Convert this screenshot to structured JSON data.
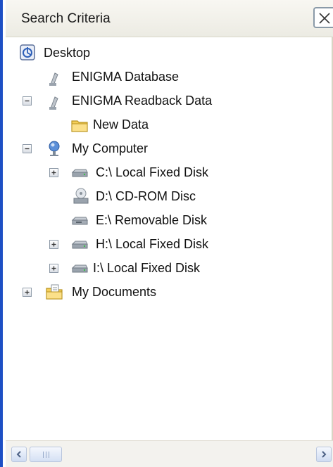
{
  "panel": {
    "title": "Search Criteria",
    "close_glyph": "X"
  },
  "tree": [
    {
      "label": "Desktop",
      "icon": "desktop-icon",
      "expander": "none",
      "depth": 0
    },
    {
      "label": "ENIGMA Database",
      "icon": "database-icon",
      "expander": "none",
      "depth": 1
    },
    {
      "label": "ENIGMA Readback Data",
      "icon": "database-icon",
      "expander": "minus",
      "depth": 1
    },
    {
      "label": "New Data",
      "icon": "folder-icon",
      "expander": "none",
      "depth": 2
    },
    {
      "label": "My Computer",
      "icon": "my-computer-icon",
      "expander": "minus",
      "depth": 1
    },
    {
      "label": "C:\\  Local Fixed Disk",
      "icon": "hard-drive-icon",
      "expander": "plus",
      "depth": 2
    },
    {
      "label": "D:\\  CD-ROM Disc",
      "icon": "cd-drive-icon",
      "expander": "none",
      "depth": 2
    },
    {
      "label": "E:\\  Removable Disk",
      "icon": "removable-drive-icon",
      "expander": "none",
      "depth": 2
    },
    {
      "label": "H:\\  Local Fixed Disk",
      "icon": "hard-drive-icon",
      "expander": "plus",
      "depth": 2
    },
    {
      "label": "I:\\  Local Fixed Disk",
      "icon": "hard-drive-icon",
      "expander": "plus",
      "depth": 2
    },
    {
      "label": "My Documents",
      "icon": "my-documents-icon",
      "expander": "plus",
      "depth": 1
    }
  ],
  "colors": {
    "panel_border": "#1d4fc4",
    "header_bg": "#f1f0ea",
    "folder": "#f5cf5a",
    "drive": "#9aa3ad"
  }
}
